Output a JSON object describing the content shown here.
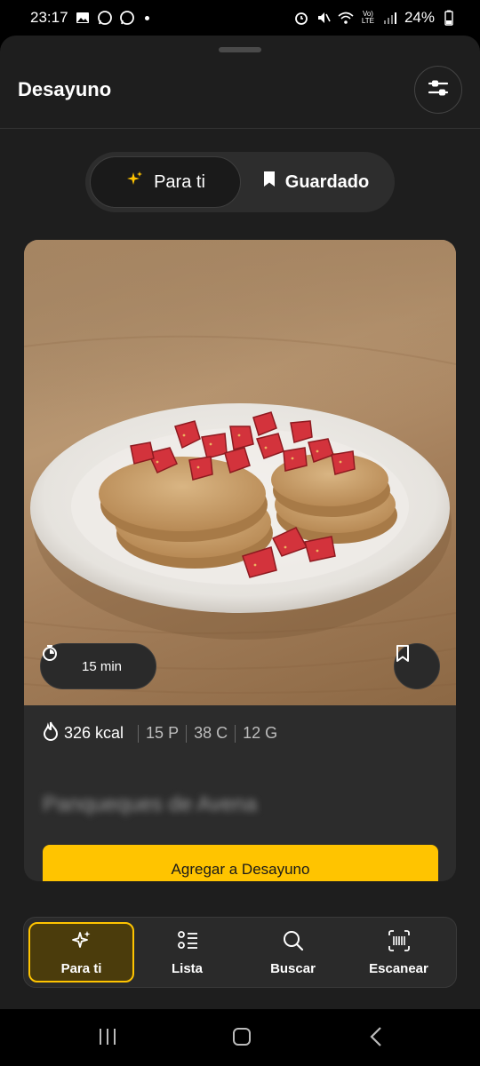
{
  "status_bar": {
    "time": "23:17",
    "battery": "24%",
    "icons_left": [
      "gallery-icon",
      "whatsapp-icon",
      "whatsapp-icon",
      "dot"
    ],
    "icons_right": [
      "alarm-icon",
      "mute-icon",
      "wifi-icon",
      "volte-icon",
      "signal-icon",
      "battery-icon"
    ]
  },
  "header": {
    "title": "Desayuno",
    "filter_icon": "sliders-icon"
  },
  "segmented": {
    "options": [
      {
        "label": "Para ti",
        "icon": "sparkles-icon",
        "active": true
      },
      {
        "label": "Guardado",
        "icon": "bookmark-icon",
        "active": false
      }
    ]
  },
  "recipe": {
    "time": "15 min",
    "kcal": "326 kcal",
    "protein": "15 P",
    "carbs": "38 C",
    "fat": "12 G",
    "name": "Panqueques de Avena",
    "add_button": "Agregar a Desayuno"
  },
  "bottom_nav": {
    "items": [
      {
        "label": "Para ti",
        "icon": "sparkles-icon",
        "active": true
      },
      {
        "label": "Lista",
        "icon": "list-icon",
        "active": false
      },
      {
        "label": "Buscar",
        "icon": "search-icon",
        "active": false
      },
      {
        "label": "Escanear",
        "icon": "barcode-scan-icon",
        "active": false
      }
    ]
  },
  "colors": {
    "accent": "#ffc400",
    "background": "#1e1e1e",
    "card": "#2c2c2c"
  }
}
